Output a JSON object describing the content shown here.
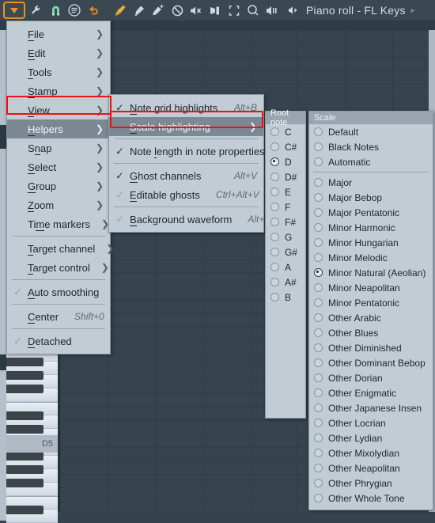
{
  "toolbar": {
    "icons": [
      {
        "name": "dropdown-arrow-icon",
        "glyph": "▼"
      },
      {
        "name": "wrench-icon",
        "glyph": "wrench"
      },
      {
        "name": "magnet-icon",
        "glyph": "magnet"
      },
      {
        "name": "menu-list-icon",
        "glyph": "list"
      },
      {
        "name": "undo-icon",
        "glyph": "undo"
      },
      {
        "name": "pencil-icon",
        "glyph": "pencil"
      },
      {
        "name": "paint-icon",
        "glyph": "paint"
      },
      {
        "name": "paint-add-icon",
        "glyph": "paint-add"
      },
      {
        "name": "delete-icon",
        "glyph": "slash"
      },
      {
        "name": "mute-icon",
        "glyph": "mute"
      },
      {
        "name": "slip-icon",
        "glyph": "slip"
      },
      {
        "name": "select-icon",
        "glyph": "select"
      },
      {
        "name": "zoom-icon",
        "glyph": "zoom"
      },
      {
        "name": "playback-icon",
        "glyph": "playback"
      }
    ],
    "title": "Piano roll - FL Keys",
    "title_arrow": "▸",
    "speaker_icon": "speaker"
  },
  "piano": {
    "key_label": "D5"
  },
  "menu_main": {
    "items": [
      {
        "label": "File",
        "accel": "F",
        "arrow": true,
        "check": null
      },
      {
        "label": "Edit",
        "accel": "E",
        "arrow": true,
        "check": null
      },
      {
        "label": "Tools",
        "accel": "T",
        "arrow": true,
        "check": null
      },
      {
        "label": "Stamp",
        "accel": "S",
        "arrow": true,
        "check": null
      },
      {
        "label": "View",
        "accel": "V",
        "arrow": true,
        "check": null
      },
      {
        "label": "Helpers",
        "accel": "H",
        "arrow": true,
        "check": null,
        "highlighted": true
      },
      {
        "label": "Snap",
        "accel": "n",
        "arrow": true,
        "check": null
      },
      {
        "label": "Select",
        "accel": "S",
        "arrow": true,
        "check": null
      },
      {
        "label": "Group",
        "accel": "G",
        "arrow": true,
        "check": null
      },
      {
        "label": "Zoom",
        "accel": "Z",
        "arrow": true,
        "check": null
      },
      {
        "label": "Time markers",
        "accel": "m",
        "arrow": true,
        "check": null
      },
      {
        "separator": true
      },
      {
        "label": "Target channel",
        "accel": "T",
        "arrow": true,
        "check": null
      },
      {
        "label": "Target control",
        "accel": "T",
        "arrow": true,
        "check": null
      },
      {
        "separator": true
      },
      {
        "label": "Auto smoothing",
        "accel": "A",
        "arrow": false,
        "check": "dim"
      },
      {
        "separator": true
      },
      {
        "label": "Center",
        "accel": "C",
        "arrow": false,
        "check": null,
        "shortcut": "Shift+0"
      },
      {
        "separator": true
      },
      {
        "label": "Detached",
        "accel": "D",
        "arrow": false,
        "check": "dim"
      }
    ]
  },
  "menu_helpers": {
    "items": [
      {
        "label": "Note grid highlights",
        "accel": "N",
        "shortcut": "Alt+B",
        "check": "on",
        "arrow": false
      },
      {
        "label": "Scale highlighting",
        "accel": "S",
        "shortcut": "",
        "check": null,
        "arrow": true,
        "highlighted": true
      },
      {
        "separator": true
      },
      {
        "label": "Note length in note properties",
        "accel": "l",
        "shortcut": "",
        "check": "on",
        "arrow": false
      },
      {
        "separator": true
      },
      {
        "label": "Ghost channels",
        "accel": "G",
        "shortcut": "Alt+V",
        "check": "on",
        "arrow": false
      },
      {
        "label": "Editable ghosts",
        "accel": "E",
        "shortcut": "Ctrl+Alt+V",
        "check": "dim",
        "arrow": false
      },
      {
        "separator": true
      },
      {
        "label": "Background waveform",
        "accel": "B",
        "shortcut": "Alt+N",
        "check": "dim",
        "arrow": false
      }
    ]
  },
  "panel_root": {
    "header": "Root note",
    "items": [
      {
        "label": "C",
        "selected": false
      },
      {
        "label": "C#",
        "selected": false
      },
      {
        "label": "D",
        "selected": true
      },
      {
        "label": "D#",
        "selected": false
      },
      {
        "label": "E",
        "selected": false
      },
      {
        "label": "F",
        "selected": false
      },
      {
        "label": "F#",
        "selected": false
      },
      {
        "label": "G",
        "selected": false
      },
      {
        "label": "G#",
        "selected": false
      },
      {
        "label": "A",
        "selected": false
      },
      {
        "label": "A#",
        "selected": false
      },
      {
        "label": "B",
        "selected": false
      }
    ]
  },
  "panel_scale": {
    "header": "Scale",
    "items": [
      {
        "label": "Default",
        "selected": false
      },
      {
        "label": "Black Notes",
        "selected": false
      },
      {
        "label": "Automatic",
        "selected": false
      },
      {
        "separator": true
      },
      {
        "label": "Major",
        "selected": false
      },
      {
        "label": "Major Bebop",
        "selected": false
      },
      {
        "label": "Major Pentatonic",
        "selected": false
      },
      {
        "label": "Minor Harmonic",
        "selected": false
      },
      {
        "label": "Minor Hungarian",
        "selected": false
      },
      {
        "label": "Minor Melodic",
        "selected": false
      },
      {
        "label": "Minor Natural (Aeolian)",
        "selected": true
      },
      {
        "label": "Minor Neapolitan",
        "selected": false
      },
      {
        "label": "Minor Pentatonic",
        "selected": false
      },
      {
        "label": "Other Arabic",
        "selected": false
      },
      {
        "label": "Other Blues",
        "selected": false
      },
      {
        "label": "Other Diminished",
        "selected": false
      },
      {
        "label": "Other Dominant Bebop",
        "selected": false
      },
      {
        "label": "Other Dorian",
        "selected": false
      },
      {
        "label": "Other Enigmatic",
        "selected": false
      },
      {
        "label": "Other Japanese Insen",
        "selected": false
      },
      {
        "label": "Other Locrian",
        "selected": false
      },
      {
        "label": "Other Lydian",
        "selected": false
      },
      {
        "label": "Other Mixolydian",
        "selected": false
      },
      {
        "label": "Other Neapolitan",
        "selected": false
      },
      {
        "label": "Other Phrygian",
        "selected": false
      },
      {
        "label": "Other Whole Tone",
        "selected": false
      }
    ]
  },
  "colors": {
    "accent_orange": "#e8921f",
    "magnet_green": "#7ad9a8",
    "annotation_red": "#ee1111",
    "menu_bg": "#c2ccd4",
    "grid_bg": "#35444e",
    "toolbar_bg": "#3a4852"
  }
}
